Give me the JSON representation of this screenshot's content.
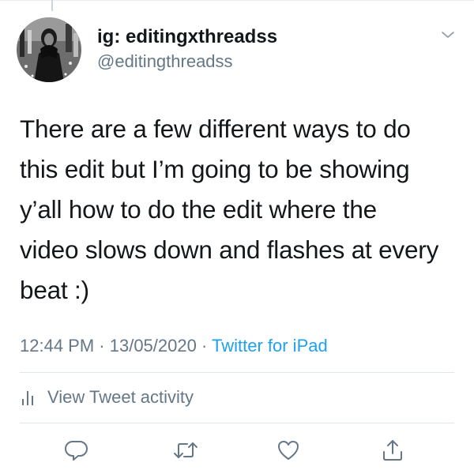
{
  "tweet": {
    "display_name": "ig: editingxthreadss",
    "handle": "@editingthreadss",
    "text_lines": [
      "There are a few different ways to do",
      "this edit but I’m going to be showing",
      "y’all how to do the edit where the",
      "video slows down and flashes at every",
      "beat :)"
    ],
    "time": "12:44 PM",
    "separator": " · ",
    "date": "13/05/2020",
    "source": "Twitter for iPad"
  },
  "activity": {
    "label": "View Tweet activity",
    "icon": "bar-chart-icon"
  },
  "actions": {
    "reply_icon": "reply-icon",
    "retweet_icon": "retweet-icon",
    "like_icon": "heart-icon",
    "share_icon": "share-icon"
  },
  "colors": {
    "text": "#14171a",
    "secondary": "#657786",
    "link": "#1da1f2",
    "divider": "#e1e8ed"
  }
}
